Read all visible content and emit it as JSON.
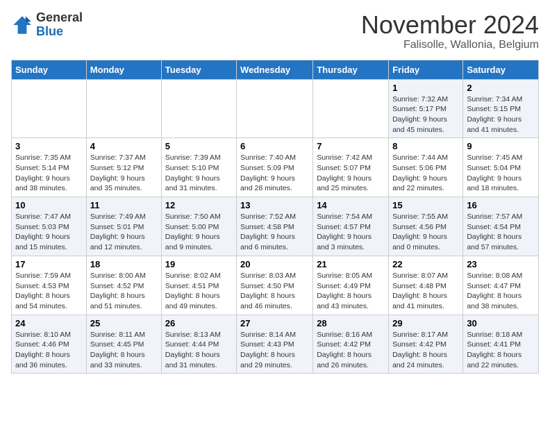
{
  "logo": {
    "general": "General",
    "blue": "Blue"
  },
  "title": "November 2024",
  "location": "Falisolle, Wallonia, Belgium",
  "days_of_week": [
    "Sunday",
    "Monday",
    "Tuesday",
    "Wednesday",
    "Thursday",
    "Friday",
    "Saturday"
  ],
  "weeks": [
    [
      {
        "day": "",
        "info": ""
      },
      {
        "day": "",
        "info": ""
      },
      {
        "day": "",
        "info": ""
      },
      {
        "day": "",
        "info": ""
      },
      {
        "day": "",
        "info": ""
      },
      {
        "day": "1",
        "info": "Sunrise: 7:32 AM\nSunset: 5:17 PM\nDaylight: 9 hours\nand 45 minutes."
      },
      {
        "day": "2",
        "info": "Sunrise: 7:34 AM\nSunset: 5:15 PM\nDaylight: 9 hours\nand 41 minutes."
      }
    ],
    [
      {
        "day": "3",
        "info": "Sunrise: 7:35 AM\nSunset: 5:14 PM\nDaylight: 9 hours\nand 38 minutes."
      },
      {
        "day": "4",
        "info": "Sunrise: 7:37 AM\nSunset: 5:12 PM\nDaylight: 9 hours\nand 35 minutes."
      },
      {
        "day": "5",
        "info": "Sunrise: 7:39 AM\nSunset: 5:10 PM\nDaylight: 9 hours\nand 31 minutes."
      },
      {
        "day": "6",
        "info": "Sunrise: 7:40 AM\nSunset: 5:09 PM\nDaylight: 9 hours\nand 28 minutes."
      },
      {
        "day": "7",
        "info": "Sunrise: 7:42 AM\nSunset: 5:07 PM\nDaylight: 9 hours\nand 25 minutes."
      },
      {
        "day": "8",
        "info": "Sunrise: 7:44 AM\nSunset: 5:06 PM\nDaylight: 9 hours\nand 22 minutes."
      },
      {
        "day": "9",
        "info": "Sunrise: 7:45 AM\nSunset: 5:04 PM\nDaylight: 9 hours\nand 18 minutes."
      }
    ],
    [
      {
        "day": "10",
        "info": "Sunrise: 7:47 AM\nSunset: 5:03 PM\nDaylight: 9 hours\nand 15 minutes."
      },
      {
        "day": "11",
        "info": "Sunrise: 7:49 AM\nSunset: 5:01 PM\nDaylight: 9 hours\nand 12 minutes."
      },
      {
        "day": "12",
        "info": "Sunrise: 7:50 AM\nSunset: 5:00 PM\nDaylight: 9 hours\nand 9 minutes."
      },
      {
        "day": "13",
        "info": "Sunrise: 7:52 AM\nSunset: 4:58 PM\nDaylight: 9 hours\nand 6 minutes."
      },
      {
        "day": "14",
        "info": "Sunrise: 7:54 AM\nSunset: 4:57 PM\nDaylight: 9 hours\nand 3 minutes."
      },
      {
        "day": "15",
        "info": "Sunrise: 7:55 AM\nSunset: 4:56 PM\nDaylight: 9 hours\nand 0 minutes."
      },
      {
        "day": "16",
        "info": "Sunrise: 7:57 AM\nSunset: 4:54 PM\nDaylight: 8 hours\nand 57 minutes."
      }
    ],
    [
      {
        "day": "17",
        "info": "Sunrise: 7:59 AM\nSunset: 4:53 PM\nDaylight: 8 hours\nand 54 minutes."
      },
      {
        "day": "18",
        "info": "Sunrise: 8:00 AM\nSunset: 4:52 PM\nDaylight: 8 hours\nand 51 minutes."
      },
      {
        "day": "19",
        "info": "Sunrise: 8:02 AM\nSunset: 4:51 PM\nDaylight: 8 hours\nand 49 minutes."
      },
      {
        "day": "20",
        "info": "Sunrise: 8:03 AM\nSunset: 4:50 PM\nDaylight: 8 hours\nand 46 minutes."
      },
      {
        "day": "21",
        "info": "Sunrise: 8:05 AM\nSunset: 4:49 PM\nDaylight: 8 hours\nand 43 minutes."
      },
      {
        "day": "22",
        "info": "Sunrise: 8:07 AM\nSunset: 4:48 PM\nDaylight: 8 hours\nand 41 minutes."
      },
      {
        "day": "23",
        "info": "Sunrise: 8:08 AM\nSunset: 4:47 PM\nDaylight: 8 hours\nand 38 minutes."
      }
    ],
    [
      {
        "day": "24",
        "info": "Sunrise: 8:10 AM\nSunset: 4:46 PM\nDaylight: 8 hours\nand 36 minutes."
      },
      {
        "day": "25",
        "info": "Sunrise: 8:11 AM\nSunset: 4:45 PM\nDaylight: 8 hours\nand 33 minutes."
      },
      {
        "day": "26",
        "info": "Sunrise: 8:13 AM\nSunset: 4:44 PM\nDaylight: 8 hours\nand 31 minutes."
      },
      {
        "day": "27",
        "info": "Sunrise: 8:14 AM\nSunset: 4:43 PM\nDaylight: 8 hours\nand 29 minutes."
      },
      {
        "day": "28",
        "info": "Sunrise: 8:16 AM\nSunset: 4:42 PM\nDaylight: 8 hours\nand 26 minutes."
      },
      {
        "day": "29",
        "info": "Sunrise: 8:17 AM\nSunset: 4:42 PM\nDaylight: 8 hours\nand 24 minutes."
      },
      {
        "day": "30",
        "info": "Sunrise: 8:18 AM\nSunset: 4:41 PM\nDaylight: 8 hours\nand 22 minutes."
      }
    ]
  ]
}
